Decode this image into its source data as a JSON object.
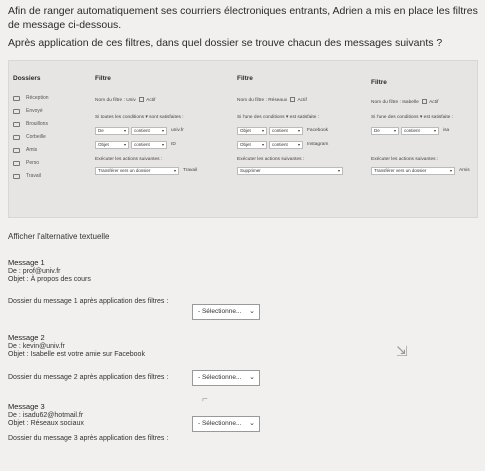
{
  "intro": {
    "line1": "Afin de ranger automatiquement ses courriers électroniques entrants, Adrien a mis en place les filtres de message ci-dessous.",
    "line2": "Après application de ces filtres, dans quel dossier se trouve chacun des messages suivants ?"
  },
  "folders": {
    "header": "Dossiers",
    "items": [
      "Réception",
      "Envoyé",
      "Brouillons",
      "Corbeille",
      "Amis",
      "Perso",
      "Travail"
    ]
  },
  "filter1": {
    "header": "Filtre",
    "name_label": "Nom du filtre :",
    "name_value": "Univ",
    "active": "Actif",
    "condition_text": "Si toutes les conditions",
    "condition_suffix": "sont satisfaites :",
    "row1": [
      "De",
      "contient",
      "univ.fr"
    ],
    "row2": [
      "Objet",
      "contient",
      "ID"
    ],
    "action_label": "Exécuter les actions suivantes :",
    "action": "Transférer vers un dossier",
    "target": "Travail"
  },
  "filter2": {
    "header": "Filtre",
    "name_label": "Nom du filtre :",
    "name_value": "Réseaux",
    "active": "Actif",
    "condition_text": "Si l'une des conditions",
    "condition_suffix": "est satisfaite :",
    "row1": [
      "Objet",
      "contient",
      "Facebook"
    ],
    "row2": [
      "Objet",
      "contient",
      "Instagram"
    ],
    "action_label": "Exécuter les actions suivantes :",
    "action": "Supprimer"
  },
  "filter3": {
    "header": "Filtre",
    "name_label": "Nom du filtre :",
    "name_value": "Isabelle",
    "active": "Actif",
    "condition_text": "Si l'une des conditions",
    "condition_suffix": "est satisfaite :",
    "row1": [
      "De",
      "contient",
      "isa"
    ],
    "action_label": "Exécuter les actions suivantes :",
    "action": "Transférer vers un dossier",
    "target": "Amis"
  },
  "toggle_text": "Afficher l'alternative textuelle",
  "messages": [
    {
      "title": "Message 1",
      "from": "De : prof@univ.fr",
      "subject": "Objet : À propos des cours",
      "prompt": "Dossier du message 1 après application des filtres :",
      "select": "- Sélectionne..."
    },
    {
      "title": "Message 2",
      "from": "De : kevin@univ.fr",
      "subject": "Objet : Isabelle est votre amie sur Facebook",
      "prompt": "Dossier du message 2 après application des filtres :",
      "select": "- Sélectionne..."
    },
    {
      "title": "Message 3",
      "from": "De : isadu62@hotmail.fr",
      "subject": "Objet : Réseaux sociaux",
      "prompt": "Dossier du message 3 après application des filtres :",
      "select": "- Sélectionne..."
    }
  ]
}
